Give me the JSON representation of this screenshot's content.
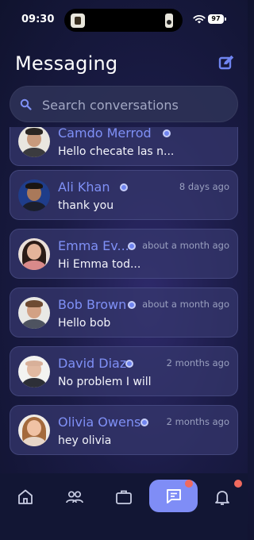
{
  "status_bar": {
    "time": "09:30",
    "battery": "97"
  },
  "header": {
    "title": "Messaging"
  },
  "search": {
    "placeholder": "Search conversations"
  },
  "conversations": [
    {
      "name": "Camdo Merrod",
      "time": "",
      "preview": "Hello checate las n..."
    },
    {
      "name": "Ali Khan",
      "time": "8 days ago",
      "preview": "thank you"
    },
    {
      "name": "Emma Ev...",
      "time": "about a month ago",
      "preview": "Hi Emma tod..."
    },
    {
      "name": "Bob Brown",
      "time": "about a month ago",
      "preview": "Hello bob"
    },
    {
      "name": "David Diaz",
      "time": "2 months ago",
      "preview": "No problem I will"
    },
    {
      "name": "Olivia Owens",
      "time": "2 months ago",
      "preview": "hey olivia"
    }
  ],
  "nav": {
    "items": [
      "home-icon",
      "people-icon",
      "briefcase-icon",
      "chat-icon",
      "bell-icon"
    ],
    "active": "chat-icon"
  },
  "colors": {
    "accent": "#7f8df6",
    "badge": "#f06a5e",
    "name": "#7f90f6"
  }
}
